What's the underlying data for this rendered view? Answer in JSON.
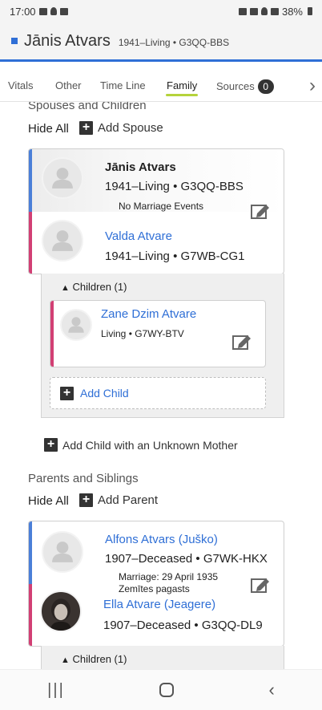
{
  "status_bar": {
    "time": "17:00",
    "battery": "38%"
  },
  "header": {
    "name": "Jānis Atvars",
    "meta": "1941–Living • G3QQ-BBS"
  },
  "tabs": [
    {
      "label": "Vitals"
    },
    {
      "label": "Other"
    },
    {
      "label": "Time Line"
    },
    {
      "label": "Family",
      "active": true
    },
    {
      "label": "Sources",
      "badge": "0"
    }
  ],
  "spouses": {
    "title": "Spouses and Children",
    "hide_all": "Hide All",
    "add_spouse": "Add Spouse",
    "husband": {
      "name": "Jānis Atvars",
      "meta": "1941–Living • G3QQ-BBS"
    },
    "event": "No Marriage Events",
    "wife": {
      "name": "Valda Atvare",
      "meta": "1941–Living • G7WB-CG1"
    },
    "children_toggle": "Children (1)",
    "child": {
      "name": "Zane Dzim Atvare",
      "meta": "Living • G7WY-BTV"
    },
    "add_child": "Add Child",
    "add_child_unknown": "Add Child with an Unknown Mother"
  },
  "parents": {
    "title": "Parents and Siblings",
    "hide_all": "Hide All",
    "add_parent": "Add Parent",
    "father": {
      "name": "Alfons Atvars (Juško)",
      "meta": "1907–Deceased • G7WK-HKX"
    },
    "marriage_date": "Marriage: 29 April 1935",
    "marriage_place": "Zemītes pagasts",
    "mother": {
      "name": "Ella Atvare (Jeagere)",
      "meta": "1907–Deceased • G3QQ-DL9"
    },
    "children_toggle": "Children (1)"
  },
  "colors": {
    "accent": "#2f6fd6",
    "male": "#4a7fd8",
    "female": "#d23f74",
    "active_tab": "#b5d33b"
  }
}
